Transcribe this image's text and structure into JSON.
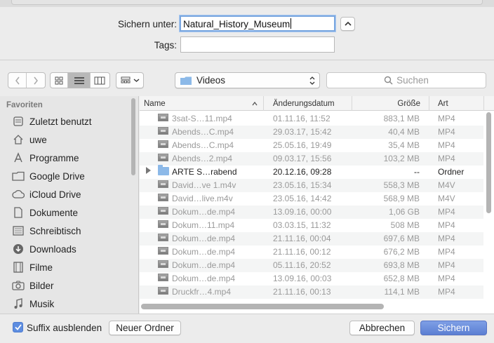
{
  "header": {
    "save_as_label": "Sichern unter:",
    "save_as_value": "Natural_History_Museum",
    "tags_label": "Tags:",
    "tags_value": ""
  },
  "toolbar": {
    "location": "Videos",
    "search_placeholder": "Suchen"
  },
  "sidebar": {
    "heading": "Favoriten",
    "items": [
      {
        "label": "Zuletzt benutzt",
        "icon": "recents-icon"
      },
      {
        "label": "uwe",
        "icon": "home-icon"
      },
      {
        "label": "Programme",
        "icon": "applications-icon"
      },
      {
        "label": "Google Drive",
        "icon": "folder-icon"
      },
      {
        "label": "iCloud Drive",
        "icon": "cloud-icon"
      },
      {
        "label": "Dokumente",
        "icon": "document-icon"
      },
      {
        "label": "Schreibtisch",
        "icon": "desktop-icon"
      },
      {
        "label": "Downloads",
        "icon": "download-icon"
      },
      {
        "label": "Filme",
        "icon": "film-icon"
      },
      {
        "label": "Bilder",
        "icon": "camera-icon"
      },
      {
        "label": "Musik",
        "icon": "music-icon"
      }
    ]
  },
  "columns": {
    "name": "Name",
    "date": "Änderungsdatum",
    "size": "Größe",
    "kind": "Art"
  },
  "files": [
    {
      "name": "3sat-S…11.mp4",
      "date": "01.11.16, 11:52",
      "size": "883,1 MB",
      "kind": "MP4"
    },
    {
      "name": "Abends…C.mp4",
      "date": "29.03.17, 15:42",
      "size": "40,4 MB",
      "kind": "MP4"
    },
    {
      "name": "Abends…C.mp4",
      "date": "25.05.16, 19:49",
      "size": "35,4 MB",
      "kind": "MP4"
    },
    {
      "name": "Abends…2.mp4",
      "date": "09.03.17, 15:56",
      "size": "103,2 MB",
      "kind": "MP4"
    },
    {
      "name": "ARTE S…rabend",
      "date": "20.12.16, 09:28",
      "size": "--",
      "kind": "Ordner"
    },
    {
      "name": "David…ve 1.m4v",
      "date": "23.05.16, 15:34",
      "size": "558,3 MB",
      "kind": "M4V"
    },
    {
      "name": "David…live.m4v",
      "date": "23.05.16, 14:42",
      "size": "568,9 MB",
      "kind": "M4V"
    },
    {
      "name": "Dokum…de.mp4",
      "date": "13.09.16, 00:00",
      "size": "1,06 GB",
      "kind": "MP4"
    },
    {
      "name": "Dokum…11.mp4",
      "date": "03.03.15, 11:32",
      "size": "508 MB",
      "kind": "MP4"
    },
    {
      "name": "Dokum…de.mp4",
      "date": "21.11.16, 00:04",
      "size": "697,6 MB",
      "kind": "MP4"
    },
    {
      "name": "Dokum…de.mp4",
      "date": "21.11.16, 00:12",
      "size": "676,2 MB",
      "kind": "MP4"
    },
    {
      "name": "Dokum…de.mp4",
      "date": "05.11.16, 20:52",
      "size": "693,8 MB",
      "kind": "MP4"
    },
    {
      "name": "Dokum…de.mp4",
      "date": "13.09.16, 00:03",
      "size": "652,8 MB",
      "kind": "MP4"
    },
    {
      "name": "Druckfr…4.mp4",
      "date": "21.11.16, 00:13",
      "size": "114,1 MB",
      "kind": "MP4"
    }
  ],
  "footer": {
    "hide_extension_label": "Suffix ausblenden",
    "new_folder_label": "Neuer Ordner",
    "cancel_label": "Abbrechen",
    "save_label": "Sichern"
  }
}
